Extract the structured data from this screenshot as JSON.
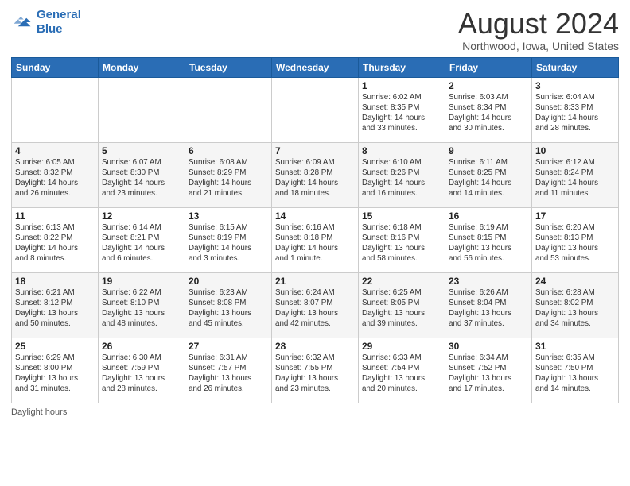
{
  "logo": {
    "line1": "General",
    "line2": "Blue"
  },
  "title": "August 2024",
  "location": "Northwood, Iowa, United States",
  "days_of_week": [
    "Sunday",
    "Monday",
    "Tuesday",
    "Wednesday",
    "Thursday",
    "Friday",
    "Saturday"
  ],
  "footer_label": "Daylight hours",
  "weeks": [
    [
      {
        "day": "",
        "info": ""
      },
      {
        "day": "",
        "info": ""
      },
      {
        "day": "",
        "info": ""
      },
      {
        "day": "",
        "info": ""
      },
      {
        "day": "1",
        "info": "Sunrise: 6:02 AM\nSunset: 8:35 PM\nDaylight: 14 hours\nand 33 minutes."
      },
      {
        "day": "2",
        "info": "Sunrise: 6:03 AM\nSunset: 8:34 PM\nDaylight: 14 hours\nand 30 minutes."
      },
      {
        "day": "3",
        "info": "Sunrise: 6:04 AM\nSunset: 8:33 PM\nDaylight: 14 hours\nand 28 minutes."
      }
    ],
    [
      {
        "day": "4",
        "info": "Sunrise: 6:05 AM\nSunset: 8:32 PM\nDaylight: 14 hours\nand 26 minutes."
      },
      {
        "day": "5",
        "info": "Sunrise: 6:07 AM\nSunset: 8:30 PM\nDaylight: 14 hours\nand 23 minutes."
      },
      {
        "day": "6",
        "info": "Sunrise: 6:08 AM\nSunset: 8:29 PM\nDaylight: 14 hours\nand 21 minutes."
      },
      {
        "day": "7",
        "info": "Sunrise: 6:09 AM\nSunset: 8:28 PM\nDaylight: 14 hours\nand 18 minutes."
      },
      {
        "day": "8",
        "info": "Sunrise: 6:10 AM\nSunset: 8:26 PM\nDaylight: 14 hours\nand 16 minutes."
      },
      {
        "day": "9",
        "info": "Sunrise: 6:11 AM\nSunset: 8:25 PM\nDaylight: 14 hours\nand 14 minutes."
      },
      {
        "day": "10",
        "info": "Sunrise: 6:12 AM\nSunset: 8:24 PM\nDaylight: 14 hours\nand 11 minutes."
      }
    ],
    [
      {
        "day": "11",
        "info": "Sunrise: 6:13 AM\nSunset: 8:22 PM\nDaylight: 14 hours\nand 8 minutes."
      },
      {
        "day": "12",
        "info": "Sunrise: 6:14 AM\nSunset: 8:21 PM\nDaylight: 14 hours\nand 6 minutes."
      },
      {
        "day": "13",
        "info": "Sunrise: 6:15 AM\nSunset: 8:19 PM\nDaylight: 14 hours\nand 3 minutes."
      },
      {
        "day": "14",
        "info": "Sunrise: 6:16 AM\nSunset: 8:18 PM\nDaylight: 14 hours\nand 1 minute."
      },
      {
        "day": "15",
        "info": "Sunrise: 6:18 AM\nSunset: 8:16 PM\nDaylight: 13 hours\nand 58 minutes."
      },
      {
        "day": "16",
        "info": "Sunrise: 6:19 AM\nSunset: 8:15 PM\nDaylight: 13 hours\nand 56 minutes."
      },
      {
        "day": "17",
        "info": "Sunrise: 6:20 AM\nSunset: 8:13 PM\nDaylight: 13 hours\nand 53 minutes."
      }
    ],
    [
      {
        "day": "18",
        "info": "Sunrise: 6:21 AM\nSunset: 8:12 PM\nDaylight: 13 hours\nand 50 minutes."
      },
      {
        "day": "19",
        "info": "Sunrise: 6:22 AM\nSunset: 8:10 PM\nDaylight: 13 hours\nand 48 minutes."
      },
      {
        "day": "20",
        "info": "Sunrise: 6:23 AM\nSunset: 8:08 PM\nDaylight: 13 hours\nand 45 minutes."
      },
      {
        "day": "21",
        "info": "Sunrise: 6:24 AM\nSunset: 8:07 PM\nDaylight: 13 hours\nand 42 minutes."
      },
      {
        "day": "22",
        "info": "Sunrise: 6:25 AM\nSunset: 8:05 PM\nDaylight: 13 hours\nand 39 minutes."
      },
      {
        "day": "23",
        "info": "Sunrise: 6:26 AM\nSunset: 8:04 PM\nDaylight: 13 hours\nand 37 minutes."
      },
      {
        "day": "24",
        "info": "Sunrise: 6:28 AM\nSunset: 8:02 PM\nDaylight: 13 hours\nand 34 minutes."
      }
    ],
    [
      {
        "day": "25",
        "info": "Sunrise: 6:29 AM\nSunset: 8:00 PM\nDaylight: 13 hours\nand 31 minutes."
      },
      {
        "day": "26",
        "info": "Sunrise: 6:30 AM\nSunset: 7:59 PM\nDaylight: 13 hours\nand 28 minutes."
      },
      {
        "day": "27",
        "info": "Sunrise: 6:31 AM\nSunset: 7:57 PM\nDaylight: 13 hours\nand 26 minutes."
      },
      {
        "day": "28",
        "info": "Sunrise: 6:32 AM\nSunset: 7:55 PM\nDaylight: 13 hours\nand 23 minutes."
      },
      {
        "day": "29",
        "info": "Sunrise: 6:33 AM\nSunset: 7:54 PM\nDaylight: 13 hours\nand 20 minutes."
      },
      {
        "day": "30",
        "info": "Sunrise: 6:34 AM\nSunset: 7:52 PM\nDaylight: 13 hours\nand 17 minutes."
      },
      {
        "day": "31",
        "info": "Sunrise: 6:35 AM\nSunset: 7:50 PM\nDaylight: 13 hours\nand 14 minutes."
      }
    ]
  ]
}
